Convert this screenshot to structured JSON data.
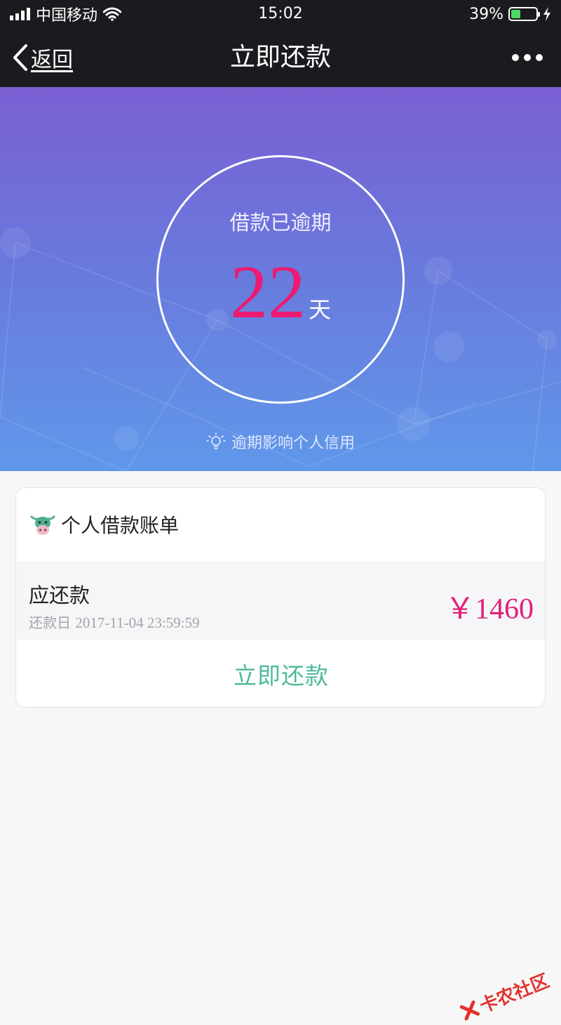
{
  "status_bar": {
    "carrier": "中国移动",
    "time": "15:02",
    "battery_percent": "39%",
    "battery_level": 0.39,
    "battery_color": "#4cd964",
    "icons": [
      "signal-icon",
      "wifi-icon",
      "battery-icon",
      "charging-bolt-icon"
    ]
  },
  "nav": {
    "back_label": "返回",
    "title": "立即还款",
    "back_icon": "chevron-left-icon",
    "more_icon": "ellipsis-icon"
  },
  "overdue": {
    "title": "借款已逾期",
    "days": "22",
    "unit": "天",
    "days_color": "#ec1b72",
    "hint": "逾期影响个人信用",
    "hint_icon": "lightbulb-icon"
  },
  "bill": {
    "header": "个人借款账单",
    "logo_icon": "cow-logo-icon",
    "due_label": "应还款",
    "date_label": "还款日",
    "date_value": "2017-11-04 23:59:59",
    "amount": "￥1460",
    "amount_color": "#e0207a",
    "repay_button": "立即还款",
    "repay_color": "#4fba9d"
  },
  "watermark": {
    "text": "卡农社区"
  }
}
